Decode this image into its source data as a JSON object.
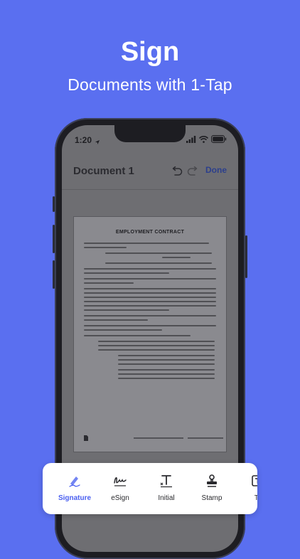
{
  "hero": {
    "title": "Sign",
    "subtitle": "Documents with 1-Tap"
  },
  "status_bar": {
    "time": "1:20"
  },
  "editor": {
    "document_title": "Document 1",
    "done_label": "Done",
    "document_heading": "EMPLOYMENT CONTRACT"
  },
  "tools": [
    {
      "label": "Signature",
      "icon": "signature-pen-icon",
      "active": true
    },
    {
      "label": "eSign",
      "icon": "esign-scribble-icon",
      "active": false
    },
    {
      "label": "Initial",
      "icon": "initial-text-icon",
      "active": false
    },
    {
      "label": "Stamp",
      "icon": "stamp-icon",
      "active": false
    },
    {
      "label": "Te",
      "icon": "text-icon",
      "active": false
    }
  ],
  "colors": {
    "background": "#5a6ff0",
    "accent": "#4a5ff0",
    "done": "#2c3f8c"
  }
}
